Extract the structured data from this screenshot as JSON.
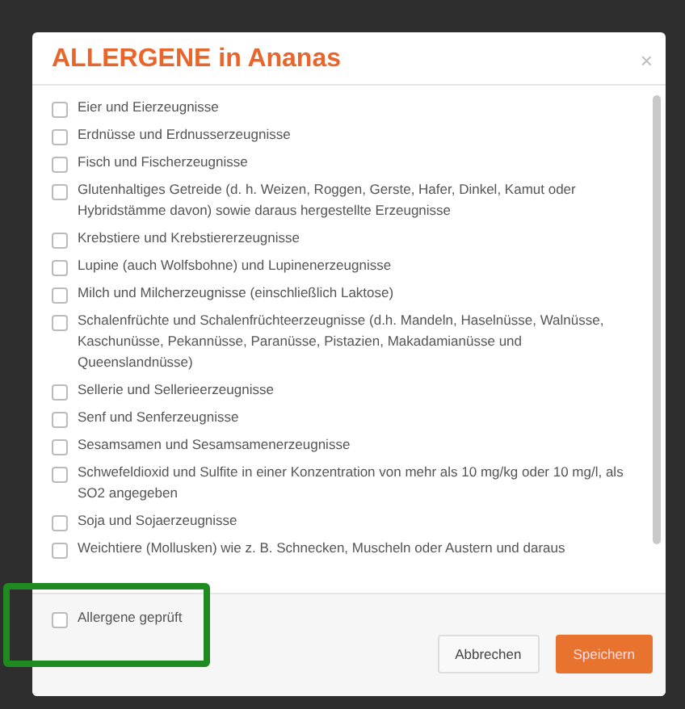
{
  "dialog": {
    "title": "ALLERGENE in Ananas",
    "close": "×"
  },
  "allergens": [
    {
      "label": "Eier und Eierzeugnisse",
      "checked": false
    },
    {
      "label": "Erdnüsse und Erdnusserzeugnisse",
      "checked": false
    },
    {
      "label": "Fisch und Fischerzeugnisse",
      "checked": false
    },
    {
      "label": "Glutenhaltiges Getreide (d. h. Weizen, Roggen, Gerste, Hafer, Dinkel, Kamut oder Hybridstämme davon) sowie daraus hergestellte Erzeugnisse",
      "checked": false
    },
    {
      "label": "Krebstiere und Krebstiererzeugnisse",
      "checked": false
    },
    {
      "label": "Lupine (auch Wolfsbohne) und Lupinenerzeugnisse",
      "checked": false
    },
    {
      "label": "Milch und Milcherzeugnisse (einschließlich Laktose)",
      "checked": false
    },
    {
      "label": "Schalenfrüchte und Schalenfrüchteerzeugnisse (d.h. Mandeln, Haselnüsse, Walnüsse, Kaschunüsse, Pekannüsse, Paranüsse, Pistazien, Makadamianüsse und Queenslandnüsse)",
      "checked": false
    },
    {
      "label": "Sellerie und Sellerieerzeugnisse",
      "checked": false
    },
    {
      "label": "Senf und Senferzeugnisse",
      "checked": false
    },
    {
      "label": "Sesamsamen und Sesamsamenerzeugnisse",
      "checked": false
    },
    {
      "label": "Schwefeldioxid und Sulfite in einer Konzentration von mehr als 10 mg/kg oder 10 mg/l, als SO2 angegeben",
      "checked": false
    },
    {
      "label": "Soja und Sojaerzeugnisse",
      "checked": false
    },
    {
      "label": "Weichtiere (Mollusken) wie z. B. Schnecken, Muscheln oder Austern und daraus",
      "checked": false
    }
  ],
  "footer": {
    "confirm": {
      "label": "Allergene geprüft",
      "checked": false
    },
    "buttons": [
      {
        "label": "Abbrechen",
        "kind": "default"
      },
      {
        "label": "Speichern",
        "kind": "primary"
      }
    ]
  }
}
